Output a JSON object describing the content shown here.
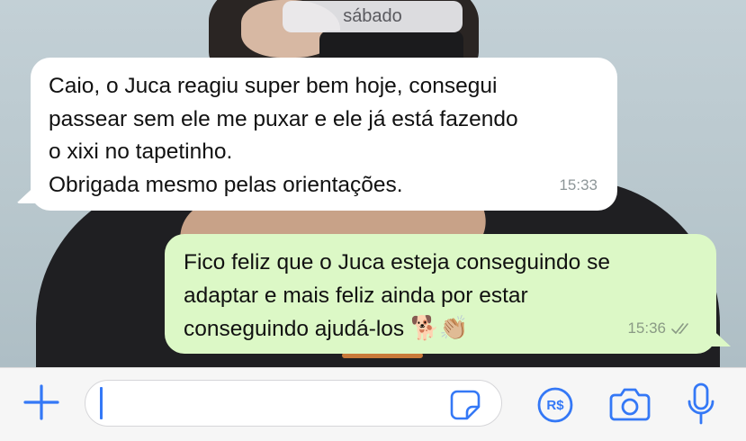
{
  "date_divider": "sábado",
  "messages": [
    {
      "direction": "incoming",
      "lines": [
        "Caio, o Juca reagiu super bem hoje, consegui",
        "passear sem ele me puxar e ele já está fazendo",
        "o xixi no tapetinho.",
        "Obrigada mesmo pelas orientações."
      ],
      "time": "15:33"
    },
    {
      "direction": "outgoing",
      "lines": [
        "Fico feliz que o Juca esteja conseguindo se",
        "adaptar e mais feliz ainda por estar",
        "conseguindo ajudá-los"
      ],
      "emoji": "🐕👏🏼",
      "time": "15:36",
      "status": "read"
    }
  ],
  "input_bar": {
    "placeholder": "",
    "icons": [
      "plus-icon",
      "sticker-icon",
      "payment-icon",
      "camera-icon",
      "microphone-icon"
    ],
    "pay_label": "R$"
  },
  "colors": {
    "accent": "#3478f6",
    "incoming_bubble": "#ffffff",
    "outgoing_bubble": "#dcf8c6"
  }
}
